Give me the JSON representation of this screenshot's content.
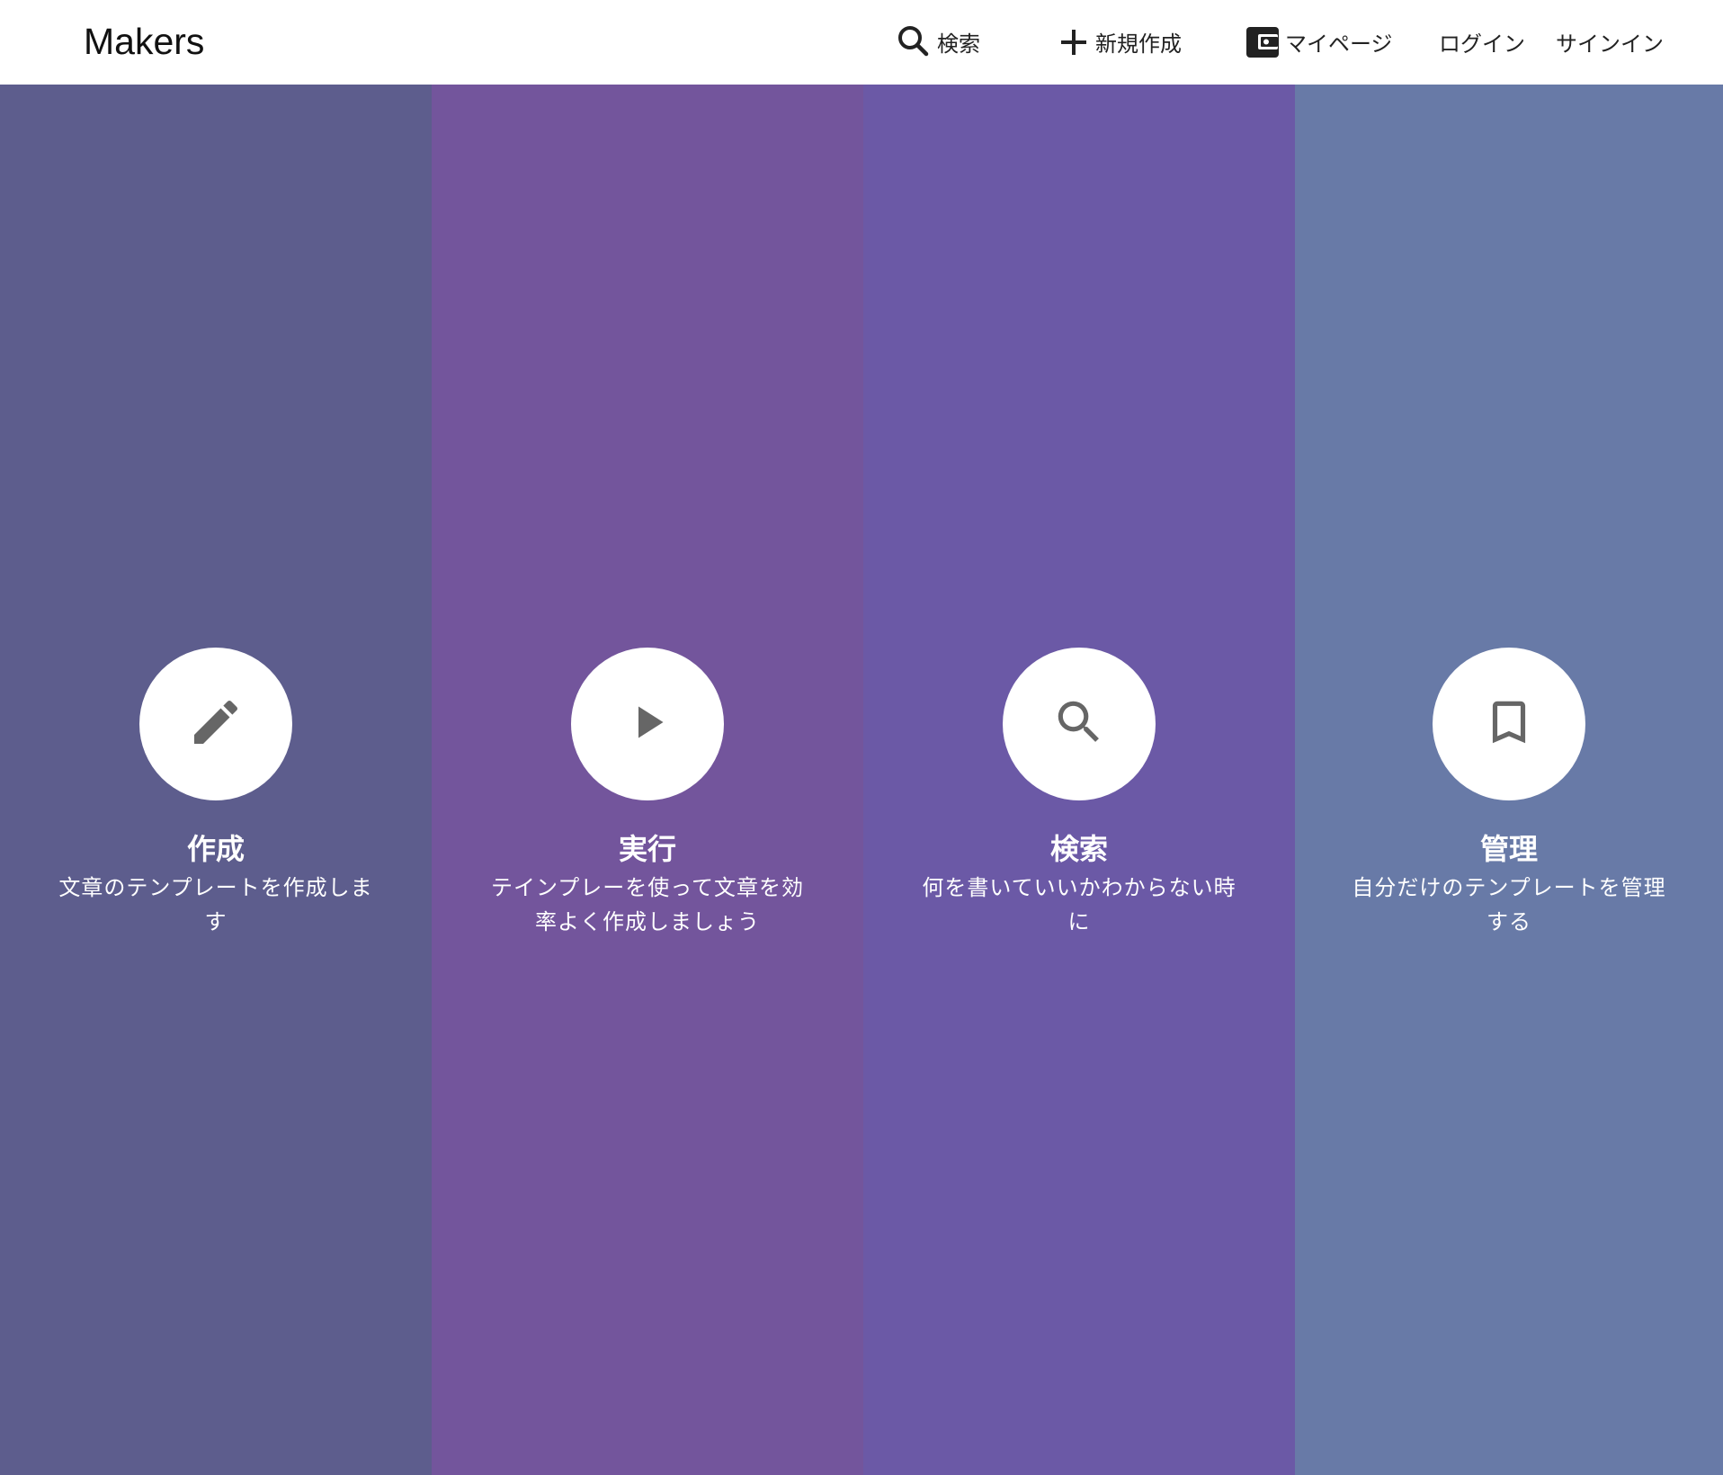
{
  "header": {
    "brand": "Makers",
    "nav": {
      "search": "検索",
      "new": "新規作成",
      "mypage": "マイページ",
      "login": "ログイン",
      "signin": "サインイン"
    }
  },
  "features": [
    {
      "title": "作成",
      "desc": "文章のテンプレートを作成します",
      "icon": "pencil-icon",
      "color": "#5d5d8d"
    },
    {
      "title": "実行",
      "desc": "テインプレーを使って文章を効率よく作成しましょう",
      "icon": "play-icon",
      "color": "#73559c"
    },
    {
      "title": "検索",
      "desc": "何を書いていいかわからない時に",
      "icon": "search-icon",
      "color": "#6b59a6"
    },
    {
      "title": "管理",
      "desc": "自分だけのテンプレートを管理する",
      "icon": "bookmark-icon",
      "color": "#687aa7"
    }
  ]
}
